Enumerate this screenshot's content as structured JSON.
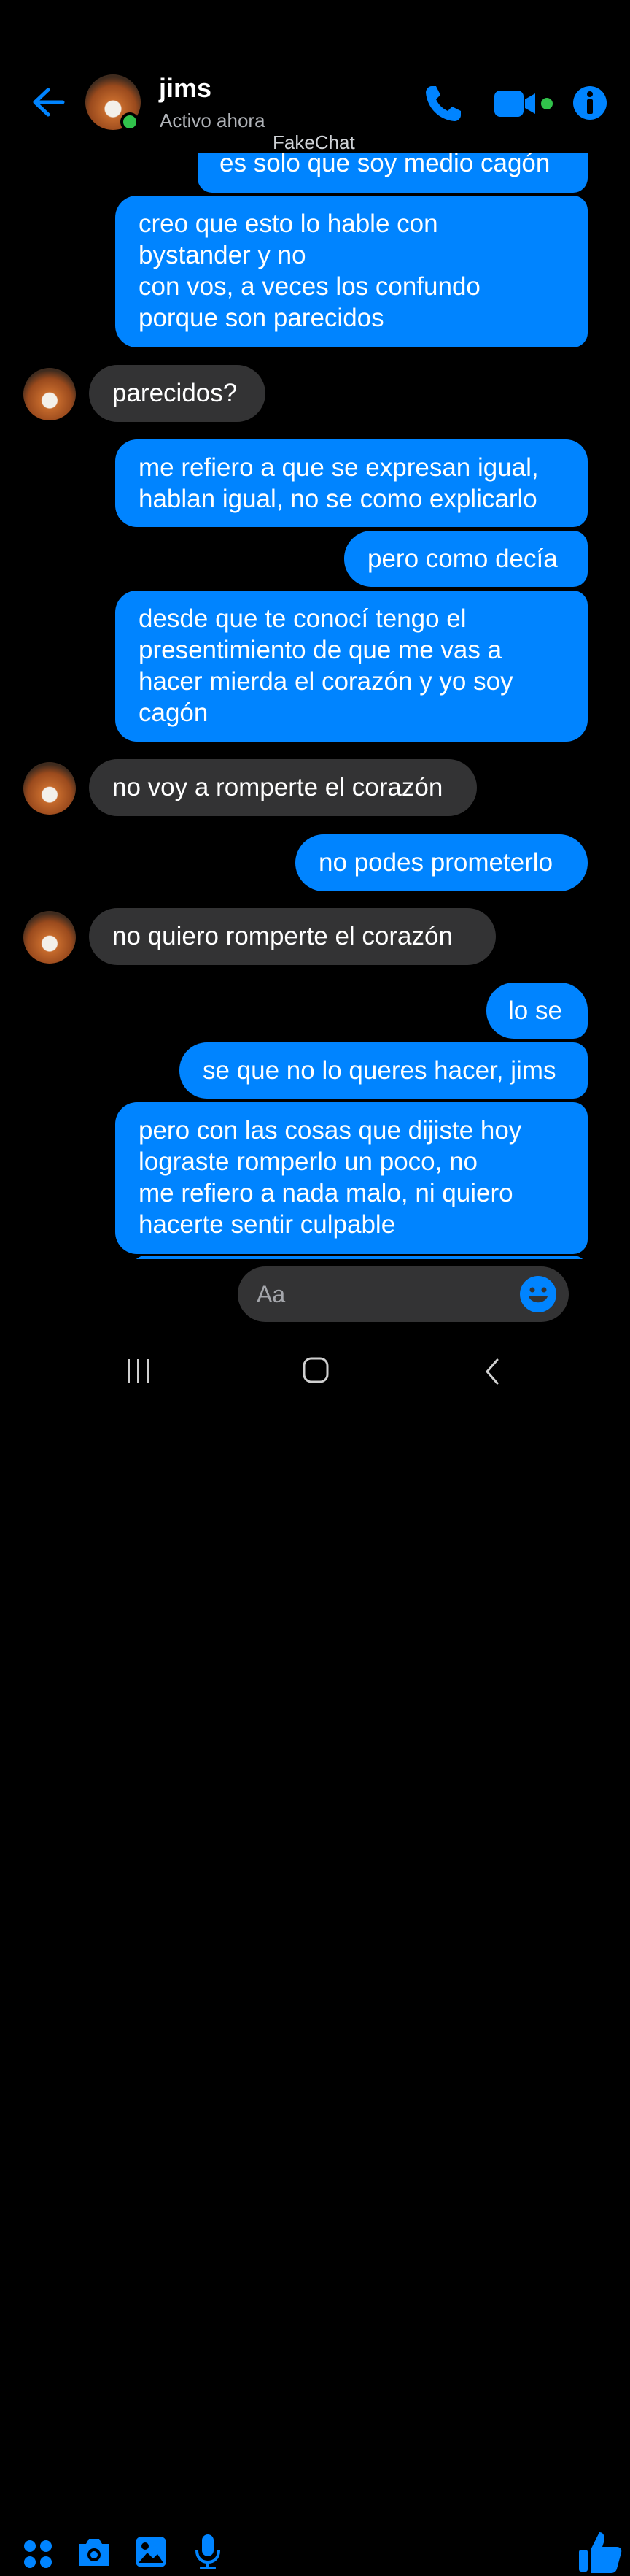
{
  "header": {
    "contact_name": "jims",
    "status": "Activo ahora",
    "watermark": "FakeChat",
    "icons": [
      "back-arrow-icon",
      "phone-icon",
      "video-call-icon",
      "info-icon"
    ],
    "accent_color": "#0084ff",
    "online_color": "#31c24b"
  },
  "messages": [
    {
      "side": "sent",
      "lines": [
        "es solo que soy medio cagón"
      ]
    },
    {
      "side": "sent",
      "lines": [
        "creo que esto lo hable con",
        "bystander y no",
        "con vos, a veces los confundo",
        "porque son parecidos"
      ]
    },
    {
      "side": "received",
      "lines": [
        "parecidos?"
      ]
    },
    {
      "side": "sent",
      "lines": [
        "me refiero a que se expresan igual,",
        "hablan igual, no se como explicarlo"
      ]
    },
    {
      "side": "sent",
      "lines": [
        "pero como decía"
      ]
    },
    {
      "side": "sent",
      "lines": [
        "desde que te conocí tengo el",
        "presentimiento de que me vas a",
        "hacer mierda el corazón y yo soy",
        "cagón"
      ]
    },
    {
      "side": "received",
      "lines": [
        "no voy a romperte el corazón"
      ]
    },
    {
      "side": "sent",
      "lines": [
        "no podes prometerlo"
      ]
    },
    {
      "side": "received",
      "lines": [
        "no quiero romperte el corazón"
      ]
    },
    {
      "side": "sent",
      "lines": [
        "lo se"
      ]
    },
    {
      "side": "sent",
      "lines": [
        "se que no lo queres hacer, jims"
      ]
    },
    {
      "side": "sent",
      "lines": [
        "pero con las cosas que dijiste hoy",
        "lograste romperlo un poco, no",
        "me refiero a nada malo, ni quiero",
        "hacerte sentir culpable"
      ]
    }
  ],
  "composer": {
    "placeholder": "Aa",
    "icons": [
      "apps-grid-icon",
      "camera-icon",
      "gallery-icon",
      "microphone-icon",
      "emoji-icon",
      "thumbs-up-icon"
    ]
  },
  "navbar": {
    "icons": [
      "recents-icon",
      "home-icon",
      "back-icon"
    ]
  }
}
